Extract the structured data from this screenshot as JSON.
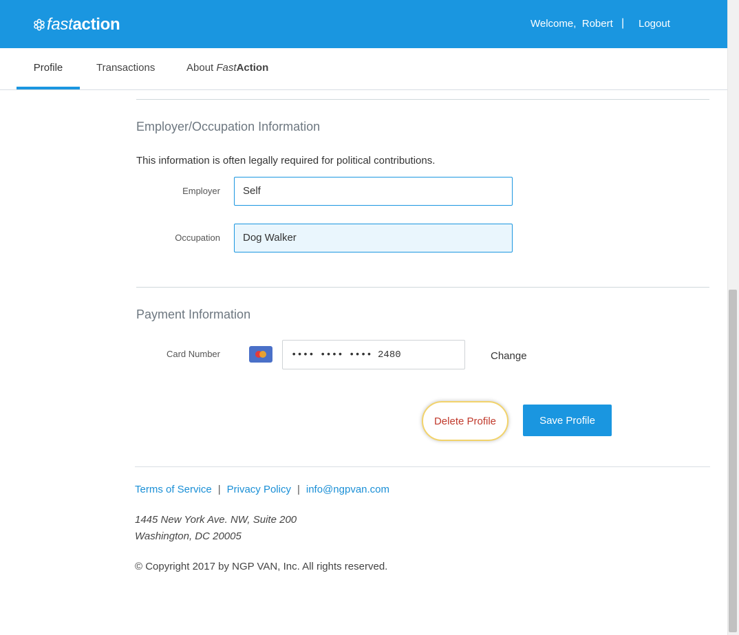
{
  "header": {
    "logo_fast": "fast",
    "logo_action": "action",
    "welcome_text": "Welcome,  Robert",
    "separator": "|",
    "logout_label": "Logout",
    "brand_color": "#1a96e0"
  },
  "nav": {
    "tabs": [
      {
        "label": "Profile",
        "active": true
      },
      {
        "label": "Transactions",
        "active": false
      },
      {
        "label_prefix": "About ",
        "label_italic": "Fast",
        "label_bold": "Action",
        "active": false
      }
    ]
  },
  "employer_section": {
    "title": "Employer/Occupation Information",
    "note": "This information is often legally required for political contributions.",
    "employer_label": "Employer",
    "employer_value": "Self",
    "occupation_label": "Occupation",
    "occupation_value": "Dog Walker"
  },
  "payment_section": {
    "title": "Payment Information",
    "card_label": "Card Number",
    "card_value": "•••• •••• •••• 2480",
    "card_icon": "mastercard-icon",
    "change_label": "Change"
  },
  "actions": {
    "delete_label": "Delete Profile",
    "save_label": "Save Profile"
  },
  "footer": {
    "terms": "Terms of Service",
    "privacy": "Privacy Policy",
    "email": "info@ngpvan.com",
    "address_line1": "1445 New York Ave. NW, Suite 200",
    "address_line2": "Washington, DC 20005",
    "copyright": "© Copyright 2017 by NGP VAN, Inc. All rights reserved."
  }
}
